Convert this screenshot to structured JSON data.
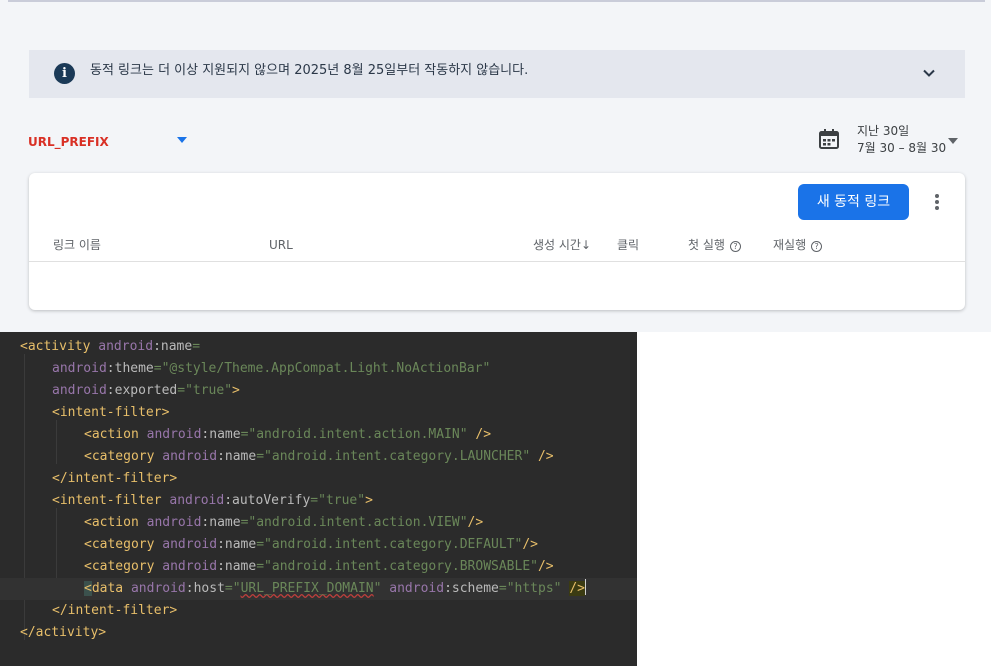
{
  "banner": {
    "message": "동적 링크는 더 이상 지원되지 않으며 2025년 8월 25일부터 작동하지 않습니다."
  },
  "filter": {
    "selected_prefix": "URL_PREFIX"
  },
  "date_range": {
    "label": "지난 30일",
    "dates": "7월 30 – 8월 30"
  },
  "table": {
    "new_button_label": "새 동적 링크",
    "columns": [
      "링크 이름",
      "URL",
      "생성 시간",
      "클릭",
      "첫 실행",
      "재실행"
    ],
    "sort_indicator": "↓",
    "help_glyph": "?"
  },
  "colors": {
    "accent": "#1a73e8",
    "prefix_red": "#d93025",
    "editor_bg": "#2b2b2b"
  },
  "icons": [
    "info-icon",
    "chevron-down-icon",
    "dropdown-caret-icon",
    "calendar-icon",
    "more-vert-icon",
    "help-circle-icon",
    "sort-down-icon"
  ],
  "code": {
    "lines": [
      {
        "indent": 0,
        "active": false,
        "tokens": [
          {
            "c": "t",
            "s": "<activity "
          },
          {
            "c": "ns",
            "s": "android"
          },
          {
            "c": "at",
            "s": ":name"
          },
          {
            "c": "v",
            "s": "="
          }
        ]
      },
      {
        "indent": 1,
        "active": false,
        "tokens": [
          {
            "c": "ns",
            "s": "android"
          },
          {
            "c": "at",
            "s": ":theme"
          },
          {
            "c": "v",
            "s": "=\"@style/Theme.AppCompat.Light.NoActionBar\""
          }
        ]
      },
      {
        "indent": 1,
        "active": false,
        "tokens": [
          {
            "c": "ns",
            "s": "android"
          },
          {
            "c": "at",
            "s": ":exported"
          },
          {
            "c": "v",
            "s": "=\"true\""
          },
          {
            "c": "t",
            "s": ">"
          }
        ]
      },
      {
        "indent": 1,
        "active": false,
        "tokens": [
          {
            "c": "t",
            "s": "<intent-filter>"
          }
        ]
      },
      {
        "indent": 2,
        "active": false,
        "tokens": [
          {
            "c": "t",
            "s": "<action "
          },
          {
            "c": "ns",
            "s": "android"
          },
          {
            "c": "at",
            "s": ":name"
          },
          {
            "c": "v",
            "s": "=\"android.intent.action.MAIN\" "
          },
          {
            "c": "t",
            "s": "/>"
          }
        ]
      },
      {
        "indent": 2,
        "active": false,
        "tokens": [
          {
            "c": "t",
            "s": "<category "
          },
          {
            "c": "ns",
            "s": "android"
          },
          {
            "c": "at",
            "s": ":name"
          },
          {
            "c": "v",
            "s": "=\"android.intent.category.LAUNCHER\" "
          },
          {
            "c": "t",
            "s": "/>"
          }
        ]
      },
      {
        "indent": 1,
        "active": false,
        "tokens": [
          {
            "c": "t",
            "s": "</intent-filter>"
          }
        ]
      },
      {
        "indent": 1,
        "active": false,
        "tokens": [
          {
            "c": "t",
            "s": "<intent-filter "
          },
          {
            "c": "ns",
            "s": "android"
          },
          {
            "c": "at",
            "s": ":autoVerify"
          },
          {
            "c": "v",
            "s": "=\"true\""
          },
          {
            "c": "t",
            "s": ">"
          }
        ]
      },
      {
        "indent": 2,
        "active": false,
        "tokens": [
          {
            "c": "t",
            "s": "<action "
          },
          {
            "c": "ns",
            "s": "android"
          },
          {
            "c": "at",
            "s": ":name"
          },
          {
            "c": "v",
            "s": "=\"android.intent.action.VIEW\""
          },
          {
            "c": "t",
            "s": "/>"
          }
        ]
      },
      {
        "indent": 2,
        "active": false,
        "tokens": [
          {
            "c": "t",
            "s": "<category "
          },
          {
            "c": "ns",
            "s": "android"
          },
          {
            "c": "at",
            "s": ":name"
          },
          {
            "c": "v",
            "s": "=\"android.intent.category.DEFAULT\""
          },
          {
            "c": "t",
            "s": "/>"
          }
        ]
      },
      {
        "indent": 2,
        "active": false,
        "tokens": [
          {
            "c": "t",
            "s": "<category "
          },
          {
            "c": "ns",
            "s": "android"
          },
          {
            "c": "at",
            "s": ":name"
          },
          {
            "c": "v",
            "s": "=\"android.intent.category.BROWSABLE\""
          },
          {
            "c": "t",
            "s": "/>"
          }
        ]
      },
      {
        "indent": 2,
        "active": true,
        "tokens": [
          {
            "c": "t mark",
            "s": "<"
          },
          {
            "c": "t",
            "s": "data "
          },
          {
            "c": "ns",
            "s": "android"
          },
          {
            "c": "at",
            "s": ":host"
          },
          {
            "c": "v",
            "s": "=\""
          },
          {
            "c": "v err",
            "s": "URL_PREFIX_DOMAIN"
          },
          {
            "c": "v",
            "s": "\" "
          },
          {
            "c": "ns",
            "s": "android"
          },
          {
            "c": "at",
            "s": ":scheme"
          },
          {
            "c": "v",
            "s": "=\"https\" "
          },
          {
            "c": "t mark2",
            "s": "/>"
          }
        ]
      },
      {
        "indent": 1,
        "active": false,
        "tokens": [
          {
            "c": "t",
            "s": "</intent-filter>"
          }
        ]
      },
      {
        "indent": 0,
        "active": false,
        "tokens": [
          {
            "c": "t",
            "s": "</activity>"
          }
        ]
      }
    ]
  }
}
